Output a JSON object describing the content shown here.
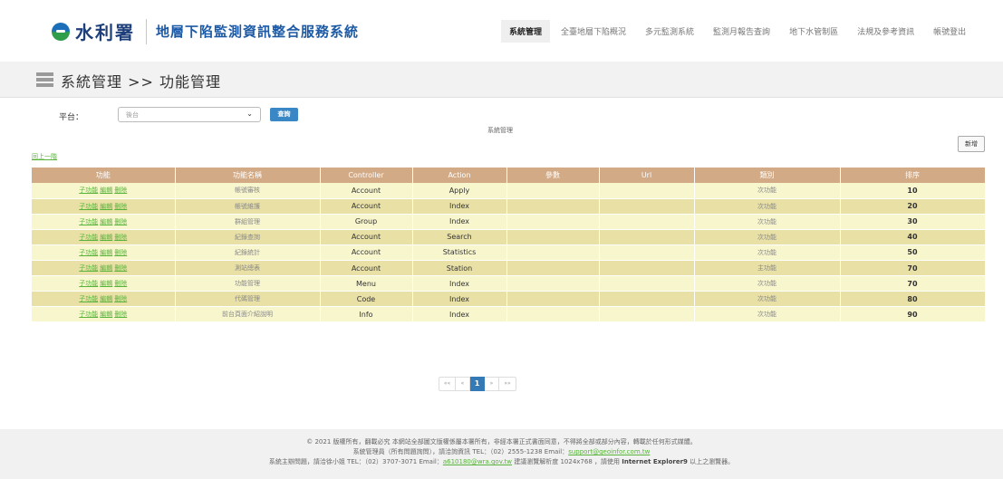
{
  "header": {
    "logo_text": "水利署",
    "system_title": "地層下陷監測資訊整合服務系統",
    "nav": [
      "系統管理",
      "全臺地層下陷概況",
      "多元監測系統",
      "監測月報告查詢",
      "地下水管制區",
      "法規及參考資訊",
      "帳號登出"
    ],
    "active_nav": "系統管理"
  },
  "page": {
    "title": "系統管理 >> 功能管理"
  },
  "filter": {
    "platform_label": "平台：",
    "platform_value": "後台",
    "query_label": "查詢"
  },
  "section_caption": "系統管理",
  "add_label": "新增",
  "back_label": "回上一階",
  "table": {
    "columns": [
      "功能",
      "功能名稱",
      "Controller",
      "Action",
      "參數",
      "Url",
      "類別",
      "排序"
    ],
    "action_links": [
      "子功能",
      "編輯",
      "刪除"
    ],
    "rows": [
      {
        "name": "帳號審核",
        "controller": "Account",
        "action": "Apply",
        "param": "",
        "url": "",
        "type": "次功能",
        "order": "10"
      },
      {
        "name": "帳號維護",
        "controller": "Account",
        "action": "Index",
        "param": "",
        "url": "",
        "type": "次功能",
        "order": "20"
      },
      {
        "name": "群組管理",
        "controller": "Group",
        "action": "Index",
        "param": "",
        "url": "",
        "type": "次功能",
        "order": "30"
      },
      {
        "name": "紀錄查詢",
        "controller": "Account",
        "action": "Search",
        "param": "",
        "url": "",
        "type": "次功能",
        "order": "40"
      },
      {
        "name": "紀錄統計",
        "controller": "Account",
        "action": "Statistics",
        "param": "",
        "url": "",
        "type": "次功能",
        "order": "50"
      },
      {
        "name": "測站總表",
        "controller": "Account",
        "action": "Station",
        "param": "",
        "url": "",
        "type": "主功能",
        "order": "70"
      },
      {
        "name": "功能管理",
        "controller": "Menu",
        "action": "Index",
        "param": "",
        "url": "",
        "type": "次功能",
        "order": "70"
      },
      {
        "name": "代碼管理",
        "controller": "Code",
        "action": "Index",
        "param": "",
        "url": "",
        "type": "次功能",
        "order": "80"
      },
      {
        "name": "前台頁面介紹說明",
        "controller": "Info",
        "action": "Index",
        "param": "",
        "url": "",
        "type": "次功能",
        "order": "90"
      }
    ]
  },
  "pager": {
    "first": "««",
    "prev": "«",
    "current": "1",
    "next": "»",
    "last": "»»"
  },
  "footer": {
    "line1": "© 2021 版權所有，翻載必究 本網站全部圖文版權係屬本署所有，非經本署正式書面同意，不得將全部或部分內容，轉載於任何形式媒體。",
    "line2_pre": "系統管理員（所有問題詢問），請洽詢資訊 TEL：（02）2555-1238 Email：",
    "line2_email": "support@geoinfor.com.tw",
    "line3_pre": "系統主辦問題，請洽徐小姐 TEL：（02）3707-3071 Email：",
    "line3_email": "a610180@wra.gov.tw",
    "line3_mid": " 建議瀏覽解析度 1024x768 ，請使用 ",
    "line3_browser": "Internet Explorer9",
    "line3_post": " 以上之瀏覽器。"
  }
}
